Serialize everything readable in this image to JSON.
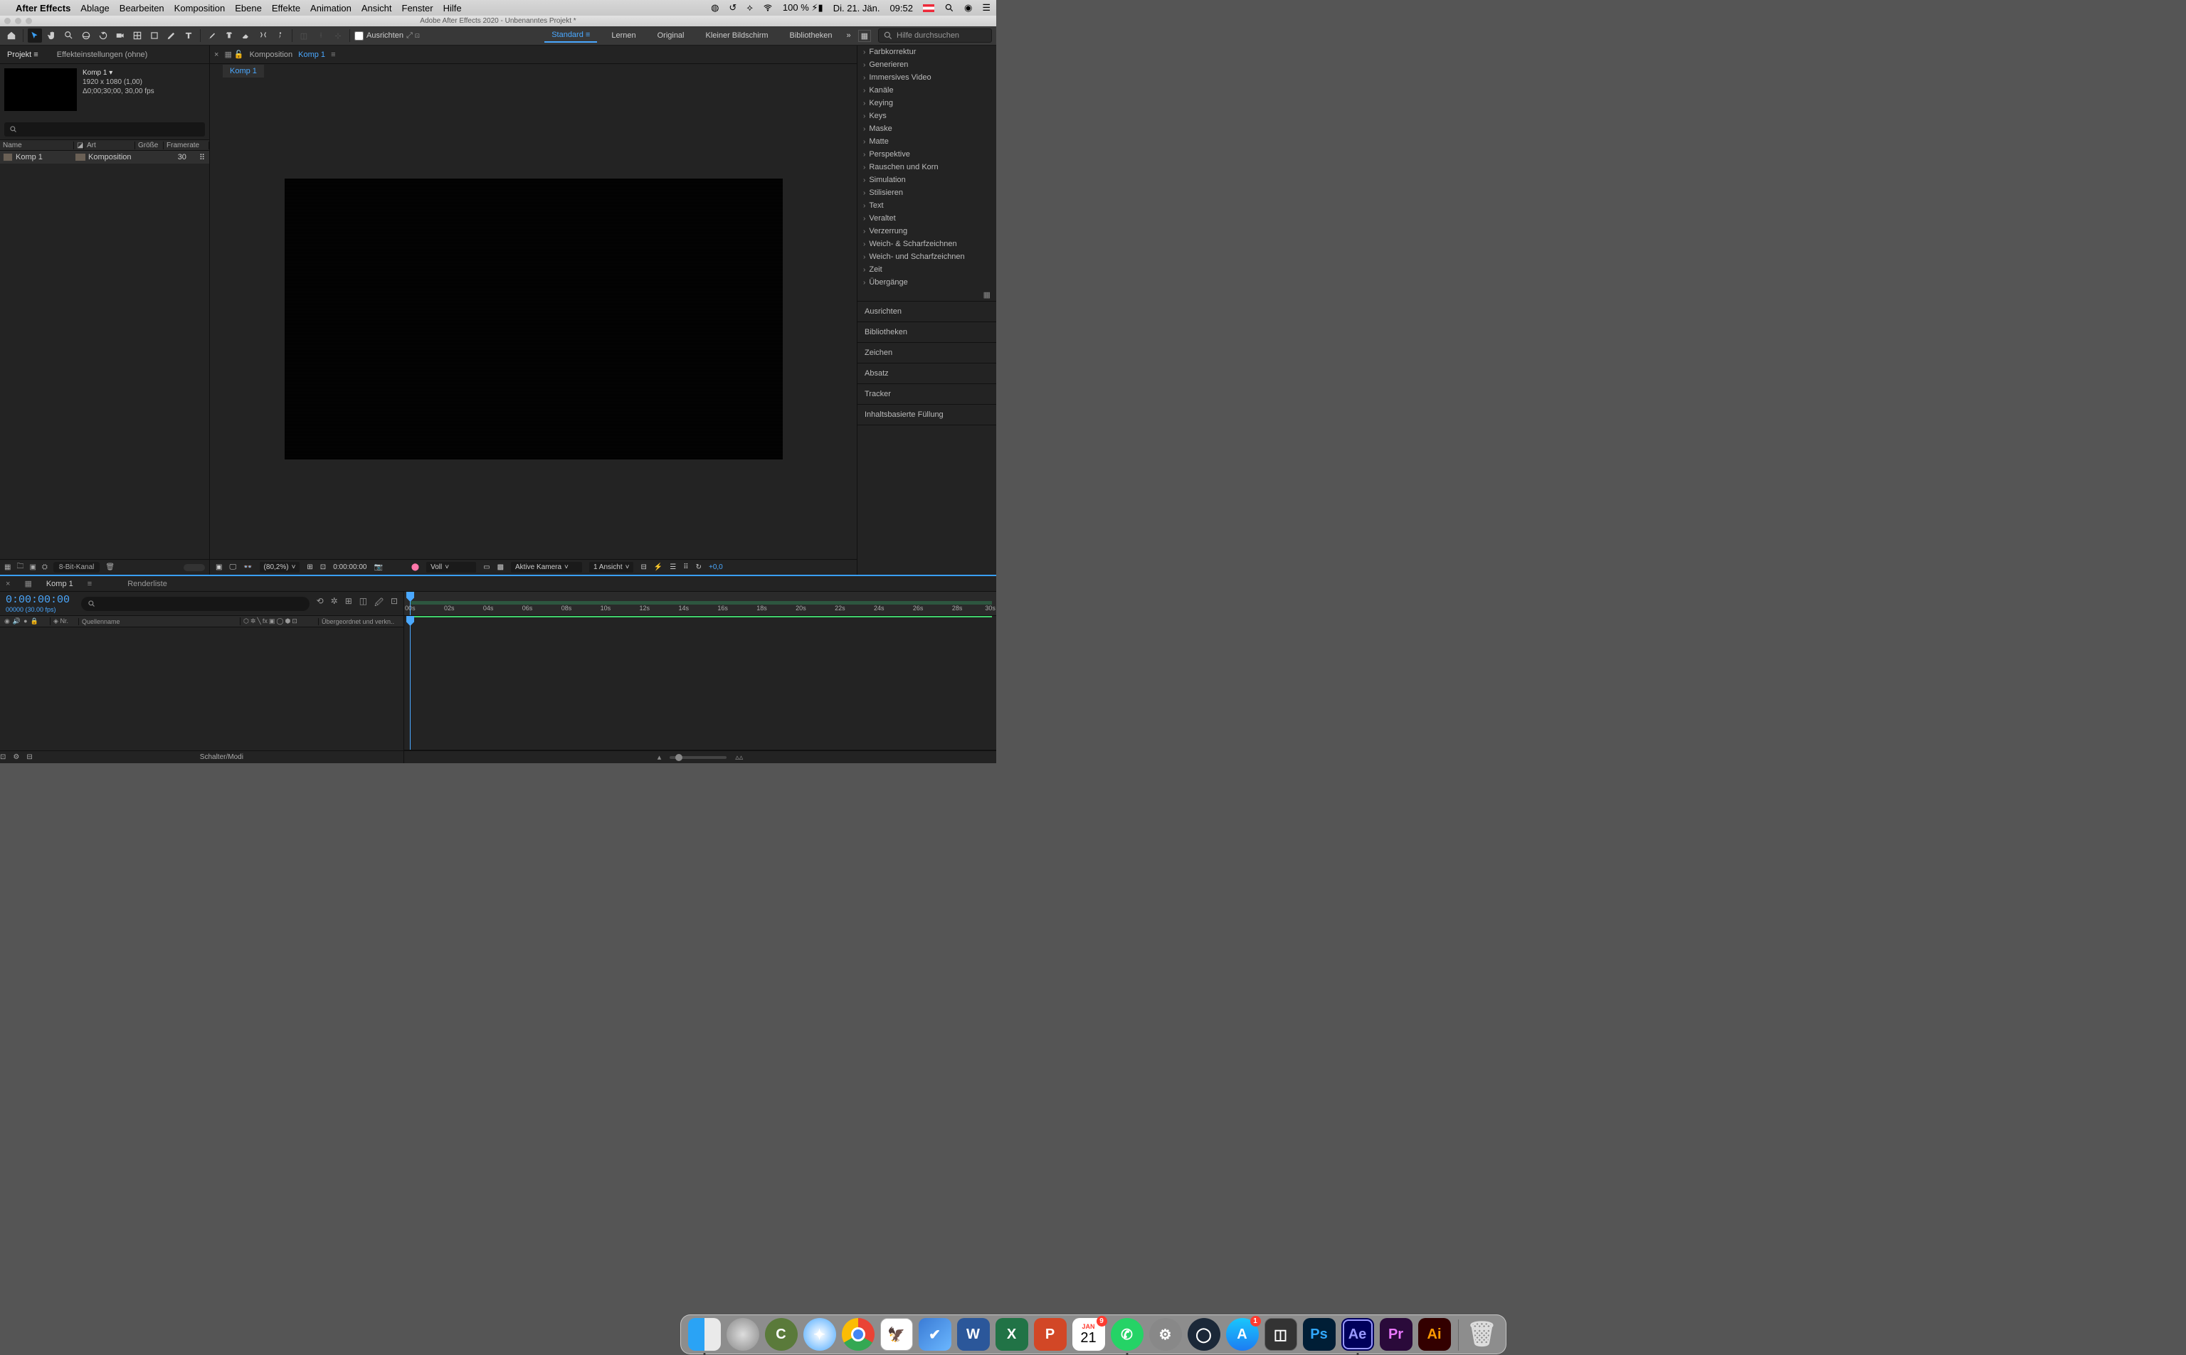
{
  "mac": {
    "app": "After Effects",
    "menus": [
      "Ablage",
      "Bearbeiten",
      "Komposition",
      "Ebene",
      "Effekte",
      "Animation",
      "Ansicht",
      "Fenster",
      "Hilfe"
    ],
    "battery": "100 %",
    "date": "Di. 21. Jän.",
    "time": "09:52"
  },
  "window_title": "Adobe After Effects 2020 - Unbenanntes Projekt *",
  "toolbar": {
    "snap_label": "Ausrichten",
    "workspaces": [
      "Standard",
      "Lernen",
      "Original",
      "Kleiner Bildschirm",
      "Bibliotheken"
    ],
    "search_placeholder": "Hilfe durchsuchen"
  },
  "project": {
    "tab_project": "Projekt",
    "tab_effects": "Effekteinstellungen (ohne)",
    "comp_name": "Komp 1 ▾",
    "comp_res": "1920 x 1080 (1,00)",
    "comp_dur": "Δ0;00;30;00, 30,00 fps",
    "cols": {
      "name": "Name",
      "type": "Art",
      "size": "Größe",
      "fps": "Framerate"
    },
    "row": {
      "name": "Komp 1",
      "type": "Komposition",
      "fps": "30"
    },
    "bpc": "8-Bit-Kanal"
  },
  "comp_panel": {
    "prefix": "Komposition",
    "name": "Komp 1",
    "tab": "Komp 1"
  },
  "viewer_footer": {
    "zoom": "(80,2%)",
    "time": "0:00:00:00",
    "res": "Voll",
    "camera": "Aktive Kamera",
    "views": "1 Ansicht",
    "exposure": "+0,0"
  },
  "effects": [
    "Farbkorrektur",
    "Generieren",
    "Immersives Video",
    "Kanäle",
    "Keying",
    "Keys",
    "Maske",
    "Matte",
    "Perspektive",
    "Rauschen und Korn",
    "Simulation",
    "Stilisieren",
    "Text",
    "Veraltet",
    "Verzerrung",
    "Weich- & Scharfzeichnen",
    "Weich- und Scharfzeichnen",
    "Zeit",
    "Übergänge"
  ],
  "right_panels": [
    "Ausrichten",
    "Bibliotheken",
    "Zeichen",
    "Absatz",
    "Tracker",
    "Inhaltsbasierte Füllung"
  ],
  "timeline": {
    "tab": "Komp 1",
    "queue": "Renderliste",
    "tc": "0:00:00:00",
    "tc_sub": "00000 (30.00 fps)",
    "col_nr": "Nr.",
    "col_source": "Quellenname",
    "col_parent": "Übergeordnet und verkn..",
    "switches": "Schalter/Modi",
    "ticks": [
      "00s",
      "02s",
      "04s",
      "06s",
      "08s",
      "10s",
      "12s",
      "14s",
      "16s",
      "18s",
      "20s",
      "22s",
      "24s",
      "26s",
      "28s",
      "30s"
    ]
  },
  "dock": {
    "cal_month": "JAN",
    "cal_day": "21",
    "cal_badge": "9",
    "store_badge": "1"
  }
}
